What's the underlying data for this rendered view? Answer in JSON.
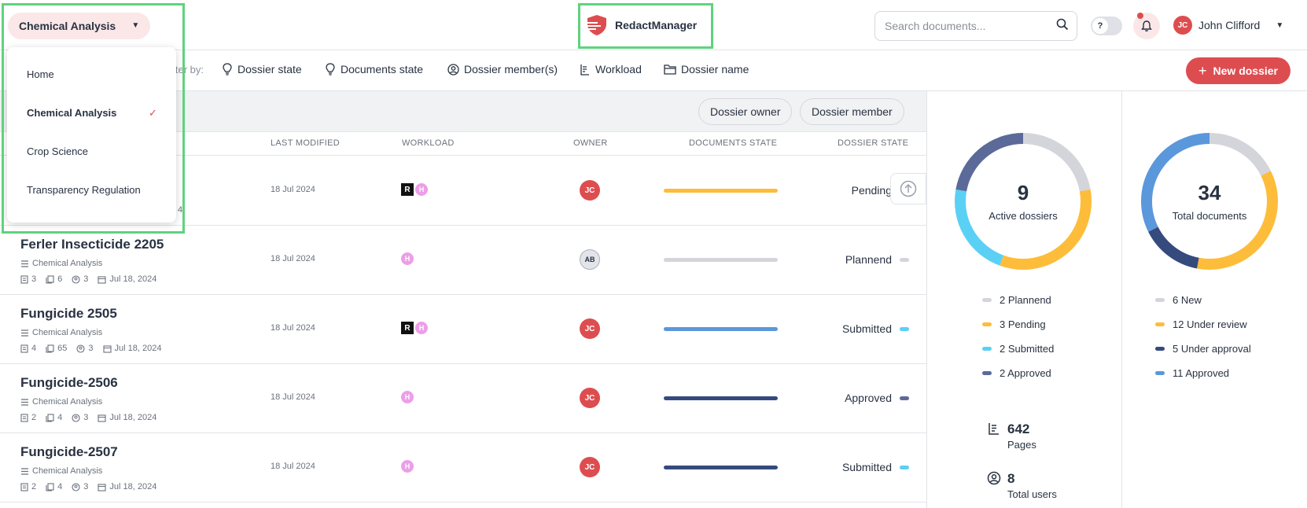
{
  "header": {
    "workspace_label": "Chemical Analysis",
    "app_name": "RedactManager",
    "search_placeholder": "Search documents...",
    "toggle_label": "?",
    "user_initials": "JC",
    "user_name": "John Clifford"
  },
  "workspace_menu": {
    "options": [
      {
        "label": "Home"
      },
      {
        "label": "Chemical Analysis",
        "selected": true
      },
      {
        "label": "Crop Science"
      },
      {
        "label": "Transparency Regulation"
      }
    ]
  },
  "filters": {
    "label": "lter by:",
    "items": [
      "Dossier state",
      "Documents state",
      "Dossier member(s)",
      "Workload",
      "Dossier name"
    ],
    "new_dossier_label": "New dossier"
  },
  "quick_filters": [
    "Dossier owner",
    "Dossier member"
  ],
  "table": {
    "columns": [
      "LAST MODIFIED",
      "WORKLOAD",
      "OWNER",
      "DOCUMENTS STATE",
      "DOSSIER STATE"
    ],
    "first_row_partial_text": "4",
    "rows": [
      {
        "title": "",
        "template": "",
        "docs": "",
        "files": "",
        "members": "",
        "date": "",
        "modified": "18 Jul 2024",
        "workload": [
          "R",
          "H"
        ],
        "owner": "JC",
        "doc_state_color": "#fdbd3a",
        "state": "Pending",
        "state_color": "#fdbd3a"
      },
      {
        "title": "Ferler Insecticide 2205",
        "template": "Chemical Analysis",
        "docs": "3",
        "files": "6",
        "members": "3",
        "date": "Jul 18, 2024",
        "modified": "18 Jul 2024",
        "workload": [
          "H"
        ],
        "owner": "AB",
        "doc_state_color": "#d3d5da",
        "state": "Plannend",
        "state_color": "#d3d5da"
      },
      {
        "title": "Fungicide 2505",
        "template": "Chemical Analysis",
        "docs": "4",
        "files": "65",
        "members": "3",
        "date": "Jul 18, 2024",
        "modified": "18 Jul 2024",
        "workload": [
          "R",
          "H"
        ],
        "owner": "JC",
        "doc_state_color": "#5b97db",
        "state": "Submitted",
        "state_color": "#5bd0f5"
      },
      {
        "title": "Fungicide-2506",
        "template": "Chemical Analysis",
        "docs": "2",
        "files": "4",
        "members": "3",
        "date": "Jul 18, 2024",
        "modified": "18 Jul 2024",
        "workload": [
          "H"
        ],
        "owner": "JC",
        "doc_state_color": "#354a7d",
        "state": "Approved",
        "state_color": "#5b6a99"
      },
      {
        "title": "Fungicide-2507",
        "template": "Chemical Analysis",
        "docs": "2",
        "files": "4",
        "members": "3",
        "date": "Jul 18, 2024",
        "modified": "18 Jul 2024",
        "workload": [
          "H"
        ],
        "owner": "JC",
        "doc_state_color": "#354a7d",
        "state": "Submitted",
        "state_color": "#5bd0f5"
      }
    ]
  },
  "dossiers_summary": {
    "total": "9",
    "label": "Active dossiers",
    "segments": [
      {
        "label": "Plannend",
        "count": 2,
        "color": "#d3d5da"
      },
      {
        "label": "Pending",
        "count": 3,
        "color": "#fdbd3a"
      },
      {
        "label": "Submitted",
        "count": 2,
        "color": "#5bd0f5"
      },
      {
        "label": "Approved",
        "count": 2,
        "color": "#5b6a99"
      }
    ],
    "legend": [
      "2 Plannend",
      "3 Pending",
      "2 Submitted",
      "2 Approved"
    ]
  },
  "documents_summary": {
    "total": "34",
    "label": "Total documents",
    "segments": [
      {
        "label": "New",
        "count": 6,
        "color": "#d3d5da"
      },
      {
        "label": "Under review",
        "count": 12,
        "color": "#fdbd3a"
      },
      {
        "label": "Under approval",
        "count": 5,
        "color": "#354a7d"
      },
      {
        "label": "Approved",
        "count": 11,
        "color": "#5b97db"
      }
    ],
    "legend": [
      "6 New",
      "12 Under review",
      "5 Under approval",
      "11 Approved"
    ]
  },
  "stats": {
    "pages_value": "642",
    "pages_label": "Pages",
    "users_value": "8",
    "users_label": "Total users"
  },
  "colors": {
    "accent": "#dd4d50",
    "highlight": "#5fd27e"
  }
}
